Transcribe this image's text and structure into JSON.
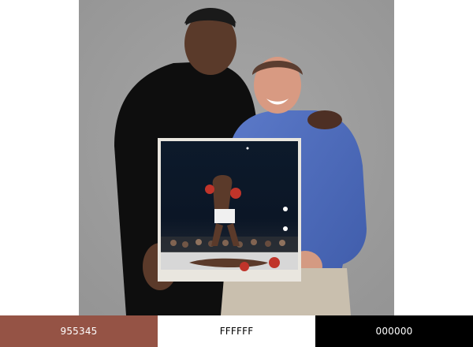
{
  "image": {
    "description_icon": "photo-image"
  },
  "palette": {
    "swatches": [
      {
        "hex": "955345",
        "color": "#955345",
        "text_color": "#ffffff"
      },
      {
        "hex": "FFFFFF",
        "color": "#FFFFFF",
        "text_color": "#000000"
      },
      {
        "hex": "000000",
        "color": "#000000",
        "text_color": "#ffffff"
      }
    ]
  }
}
